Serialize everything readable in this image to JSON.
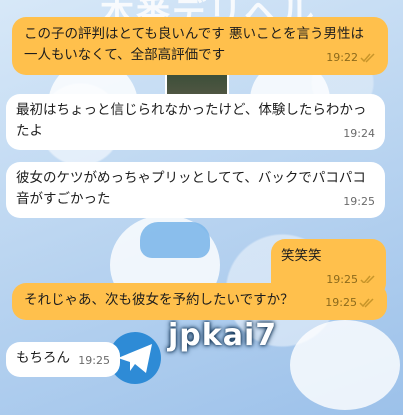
{
  "background": {
    "heading": "本番デリヘル",
    "watermark": "jpkai7"
  },
  "messages": [
    {
      "direction": "out",
      "text": "この子の評判はとても良いんです 悪いことを言う男性は一人もいなくて、全部高評価です",
      "time": "19:22",
      "read": true
    },
    {
      "direction": "in",
      "text": "最初はちょっと信じられなかったけど、体験したらわかったよ",
      "time": "19:24",
      "read": false
    },
    {
      "direction": "in",
      "text": "彼女のケツがめっちゃプリッとしてて、バックでパコパコ音がすごかった",
      "time": "19:25",
      "read": false
    },
    {
      "direction": "out",
      "text": "笑笑笑",
      "time": "19:25",
      "read": true
    },
    {
      "direction": "out",
      "text": "それじゃあ、次も彼女を予約したいですか？",
      "time": "19:25",
      "read": true
    },
    {
      "direction": "in",
      "text": "もちろん",
      "time": "19:25",
      "read": false
    }
  ],
  "colors": {
    "outgoing": "#ffc04c",
    "incoming": "#ffffff",
    "tick": "#c8952a"
  },
  "icons": {
    "read": "double-check-icon",
    "watermark_logo": "paper-plane-icon"
  }
}
